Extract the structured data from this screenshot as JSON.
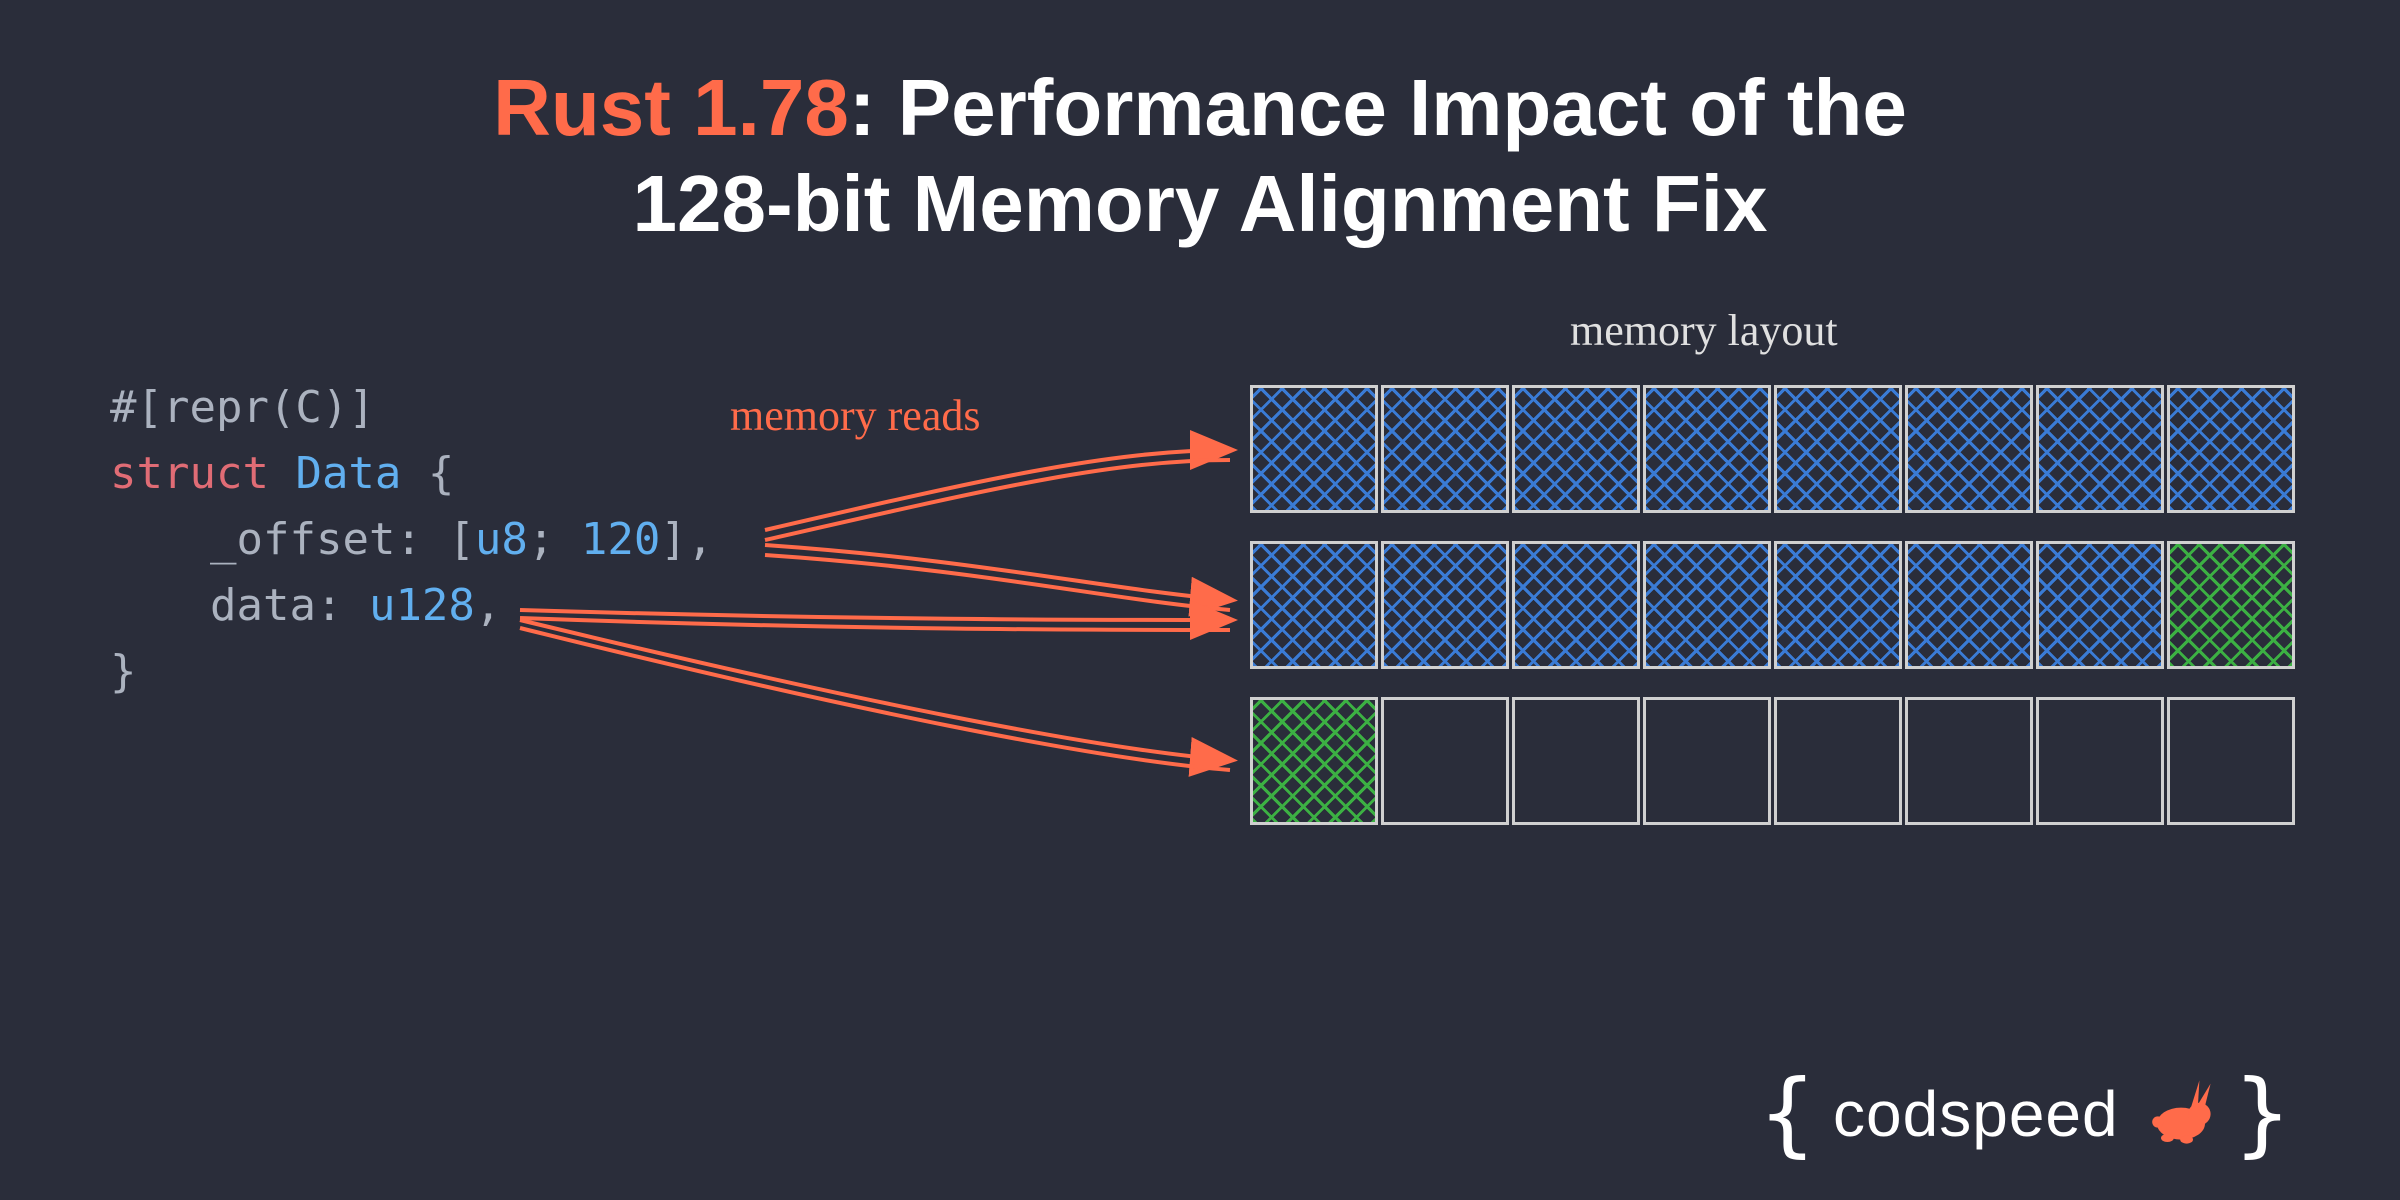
{
  "title": {
    "accent": "Rust 1.78",
    "rest1": ": Performance Impact of the",
    "rest2": "128-bit Memory Alignment Fix"
  },
  "code": {
    "attr_line": "#[repr(C)]",
    "struct_kw": "struct",
    "struct_name": "Data",
    "open_brace": " {",
    "field1_name": "_offset",
    "field1_sep": ": [",
    "field1_ty": "u8",
    "field1_sep2": "; ",
    "field1_num": "120",
    "field1_close": "],",
    "field2_name": "data",
    "field2_sep": ": ",
    "field2_ty": "u128",
    "field2_close": ",",
    "close_brace": "}"
  },
  "labels": {
    "memory_reads": "memory reads",
    "memory_layout": "memory layout"
  },
  "memory_grid": {
    "rows": [
      [
        "blue",
        "blue",
        "blue",
        "blue",
        "blue",
        "blue",
        "blue",
        "blue"
      ],
      [
        "blue",
        "blue",
        "blue",
        "blue",
        "blue",
        "blue",
        "blue",
        "green"
      ],
      [
        "green",
        "empty",
        "empty",
        "empty",
        "empty",
        "empty",
        "empty",
        "empty"
      ]
    ]
  },
  "brand": {
    "open": "{",
    "name": "codspeed",
    "close": "}",
    "accent_color": "#ff6b4a"
  },
  "colors": {
    "bg": "#2a2d3a",
    "accent": "#ff6b4a",
    "blue_cell": "#3a7bd5",
    "green_cell": "#3cb043",
    "cell_border": "#d0d0d0"
  }
}
